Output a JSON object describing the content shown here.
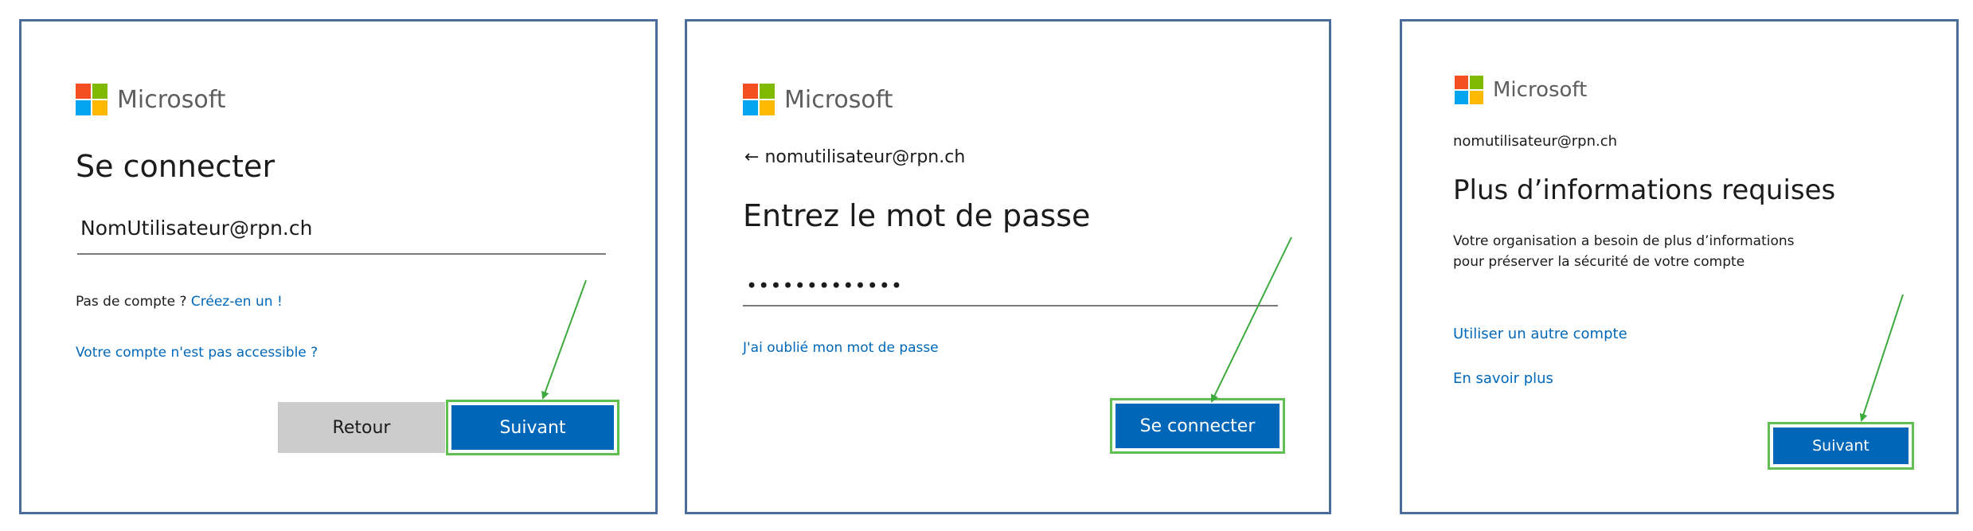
{
  "brand": {
    "name": "Microsoft"
  },
  "panel1": {
    "title": "Se connecter",
    "email_value": "NomUtilisateur@rpn.ch",
    "no_account_text": "Pas de compte ?",
    "create_link": "Créez-en un !",
    "inaccessible_link": "Votre compte n'est pas accessible ?",
    "back_button": "Retour",
    "next_button": "Suivant"
  },
  "panel2": {
    "back_arrow": "←",
    "email": "nomutilisateur@rpn.ch",
    "title": "Entrez le mot de passe",
    "password_dots": "•••••••••••••",
    "forgot_link": "J'ai oublié mon mot de passe",
    "signin_button": "Se connecter"
  },
  "panel3": {
    "email": "nomutilisateur@rpn.ch",
    "title": "Plus d’informations requises",
    "description_line1": "Votre organisation a besoin de plus d’informations",
    "description_line2": "pour préserver la sécurité de votre compte",
    "other_account_link": "Utiliser un autre compte",
    "learn_more_link": "En savoir plus",
    "next_button": "Suivant"
  },
  "colors": {
    "panel_border": "#4a6d9c",
    "primary_button": "#0067b8",
    "link": "#0067b8",
    "annotation_arrow": "#3daa3d",
    "button_highlight": "#5fbf50"
  },
  "icons": {
    "logo": "microsoft-logo-icon",
    "back": "back-arrow-icon",
    "annotation": "annotation-arrow-icon"
  }
}
